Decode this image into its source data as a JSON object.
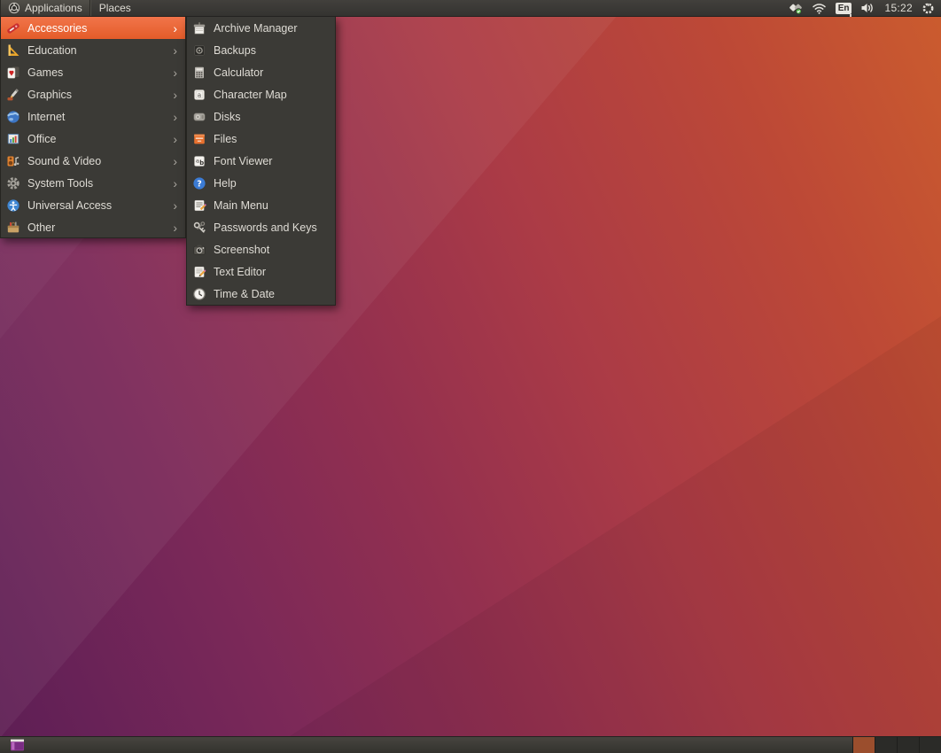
{
  "top_panel": {
    "logo_icon": "ubuntu-distributor-logo",
    "menus": [
      {
        "label": "Applications",
        "state": "open"
      },
      {
        "label": "Places",
        "state": "closed"
      }
    ],
    "indicators": {
      "updates_icon": "software-updates-icon",
      "network_icon": "wifi-signal-icon",
      "keyboard_layout": "En",
      "volume_icon": "volume-icon",
      "clock": "15:22",
      "session_icon": "power-gear-icon"
    }
  },
  "apps_menu": {
    "arrow_glyph": "›",
    "categories": [
      {
        "label": "Accessories",
        "icon": "accessories-icon",
        "selected": true
      },
      {
        "label": "Education",
        "icon": "education-icon",
        "selected": false
      },
      {
        "label": "Games",
        "icon": "games-icon",
        "selected": false
      },
      {
        "label": "Graphics",
        "icon": "graphics-icon",
        "selected": false
      },
      {
        "label": "Internet",
        "icon": "internet-icon",
        "selected": false
      },
      {
        "label": "Office",
        "icon": "office-icon",
        "selected": false
      },
      {
        "label": "Sound & Video",
        "icon": "sound-video-icon",
        "selected": false
      },
      {
        "label": "System Tools",
        "icon": "system-tools-icon",
        "selected": false
      },
      {
        "label": "Universal Access",
        "icon": "universal-access-icon",
        "selected": false
      },
      {
        "label": "Other",
        "icon": "other-icon",
        "selected": false
      }
    ]
  },
  "accessories_submenu": {
    "items": [
      {
        "label": "Archive Manager",
        "icon": "archive-manager-icon"
      },
      {
        "label": "Backups",
        "icon": "backups-icon"
      },
      {
        "label": "Calculator",
        "icon": "calculator-icon"
      },
      {
        "label": "Character Map",
        "icon": "character-map-icon"
      },
      {
        "label": "Disks",
        "icon": "disks-icon"
      },
      {
        "label": "Files",
        "icon": "files-icon"
      },
      {
        "label": "Font Viewer",
        "icon": "font-viewer-icon"
      },
      {
        "label": "Help",
        "icon": "help-icon"
      },
      {
        "label": "Main Menu",
        "icon": "main-menu-icon"
      },
      {
        "label": "Passwords and Keys",
        "icon": "passwords-keys-icon"
      },
      {
        "label": "Screenshot",
        "icon": "screenshot-icon"
      },
      {
        "label": "Text Editor",
        "icon": "text-editor-icon"
      },
      {
        "label": "Time & Date",
        "icon": "time-date-icon"
      }
    ]
  },
  "bottom_panel": {
    "show_desktop_icon": "show-desktop-button",
    "workspace_switcher": {
      "workspace_count": 4,
      "active_workspace": 1
    }
  },
  "colors": {
    "panel_bg": "#3c3b37",
    "menu_bg": "#3b3a36",
    "menu_text": "#dfdcd5",
    "selection_orange": "#ec6237",
    "active_workspace": "#9b4e2d",
    "wallpaper_top_right": "#cb5c2e",
    "wallpaper_bottom_left": "#5d1e54"
  }
}
